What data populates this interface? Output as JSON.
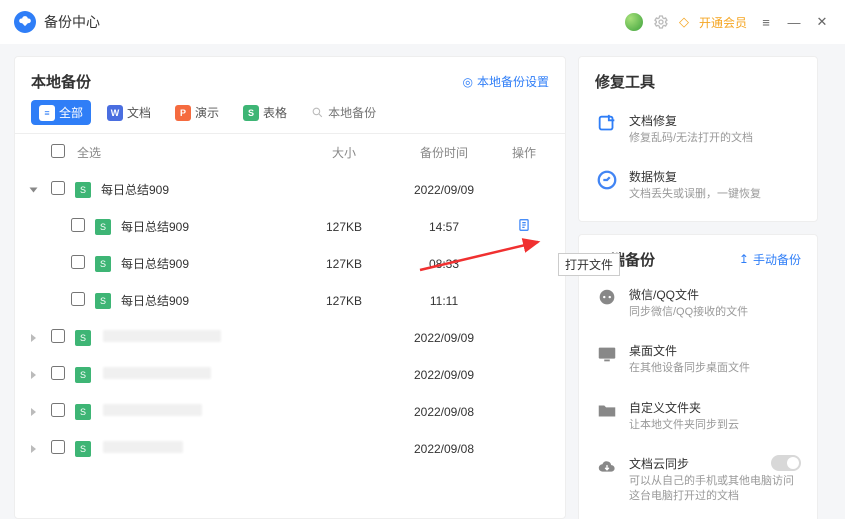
{
  "titlebar": {
    "title": "备份中心",
    "open_vip": "开通会员"
  },
  "local": {
    "title": "本地备份",
    "settings": "本地备份设置",
    "tabs": {
      "all": "全部",
      "doc": "文档",
      "ppt": "演示",
      "xls": "表格"
    },
    "search_placeholder": "本地备份",
    "columns": {
      "select_all": "全选",
      "size": "大小",
      "time": "备份时间",
      "op": "操作"
    },
    "rows": [
      {
        "kind": "group",
        "expanded": true,
        "name": "每日总结909",
        "time": "2022/09/09"
      },
      {
        "kind": "child",
        "name": "每日总结909",
        "size": "127KB",
        "time": "14:57",
        "has_open": true
      },
      {
        "kind": "child",
        "name": "每日总结909",
        "size": "127KB",
        "time": "08:33"
      },
      {
        "kind": "child",
        "name": "每日总结909",
        "size": "127KB",
        "time": "11:11"
      },
      {
        "kind": "group",
        "expanded": false,
        "name": "",
        "time": "2022/09/09",
        "blur": true
      },
      {
        "kind": "group",
        "expanded": false,
        "name": "",
        "time": "2022/09/09",
        "blur": true
      },
      {
        "kind": "group",
        "expanded": false,
        "name": "",
        "time": "2022/09/08",
        "blur": true
      },
      {
        "kind": "group",
        "expanded": false,
        "name": "",
        "time": "2022/09/08",
        "blur": true
      }
    ]
  },
  "tooltip": "打开文件",
  "repair": {
    "title": "修复工具",
    "items": [
      {
        "icon": "fix",
        "t": "文档修复",
        "d": "修复乱码/无法打开的文档"
      },
      {
        "icon": "recover",
        "t": "数据恢复",
        "d": "文档丢失或误删，一键恢复"
      }
    ]
  },
  "cloud": {
    "title": "云端备份",
    "manual": "手动备份",
    "items": [
      {
        "icon": "chat",
        "t": "微信/QQ文件",
        "d": "同步微信/QQ接收的文件"
      },
      {
        "icon": "desktop",
        "t": "桌面文件",
        "d": "在其他设备同步桌面文件"
      },
      {
        "icon": "folder",
        "t": "自定义文件夹",
        "d": "让本地文件夹同步到云"
      },
      {
        "icon": "cloud",
        "t": "文档云同步",
        "d": "可以从自己的手机或其他电脑访问这台电脑打开过的文档",
        "toggle": true
      }
    ]
  }
}
